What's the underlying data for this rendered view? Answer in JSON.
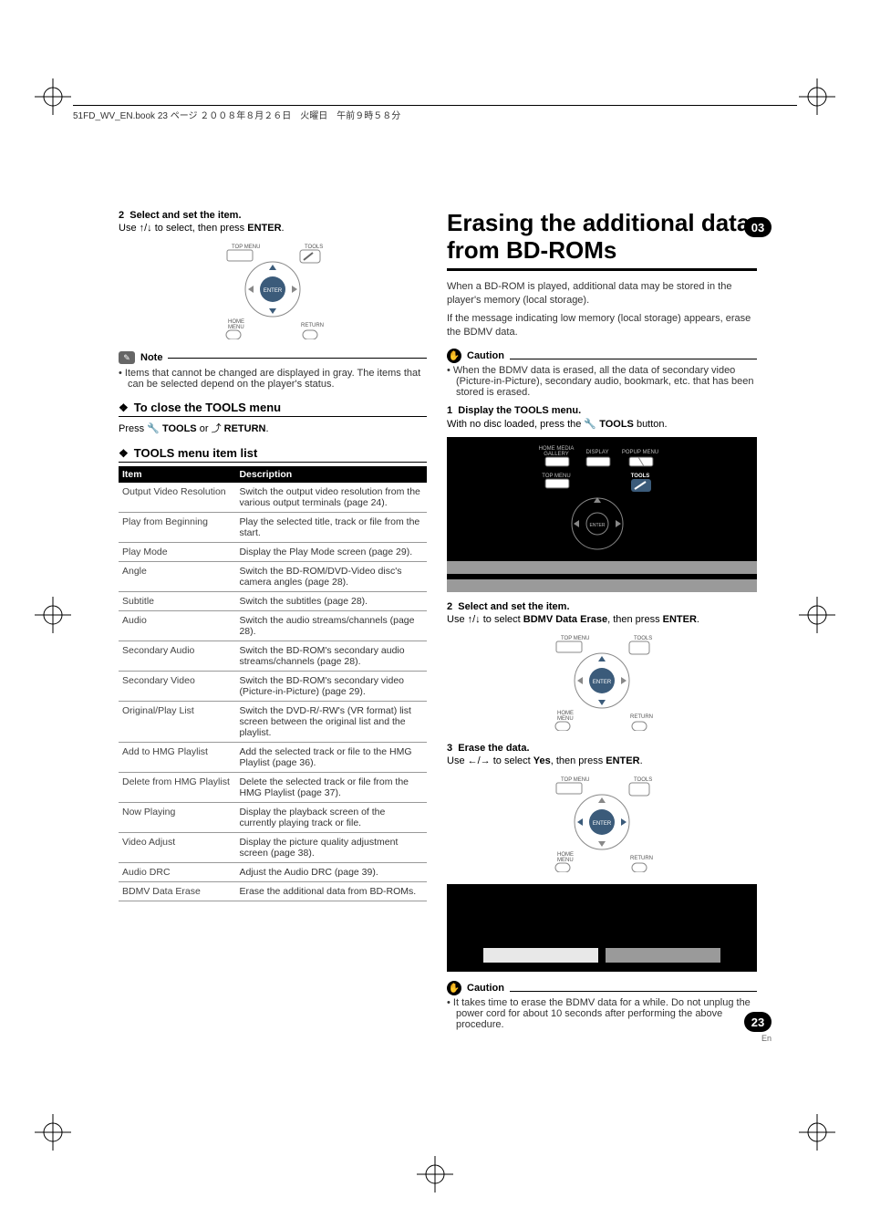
{
  "chapter_number": "03",
  "page_number": "23",
  "page_lang": "En",
  "running_header": "51FD_WV_EN.book  23 ページ  ２００８年８月２６日　火曜日　午前９時５８分",
  "left": {
    "step2_num": "2",
    "step2_title": "Select and set the item.",
    "step2_sub_pre": "Use ",
    "step2_sub_arrows": "↑/↓",
    "step2_sub_mid": " to select, then press ",
    "step2_sub_enter": "ENTER",
    "step2_sub_post": ".",
    "remote_labels": {
      "top_menu": "TOP MENU",
      "tools": "TOOLS",
      "home_menu": "HOME MENU",
      "return": "RETURN",
      "enter": "ENTER"
    },
    "note_label": "Note",
    "note_bullet": "• Items that cannot be changed are displayed in gray. The items that can be selected depend on the player's status.",
    "sect_close": "To close the TOOLS menu",
    "press_pre": "Press ",
    "press_tools": "TOOLS",
    "press_or": " or ",
    "press_return": "RETURN",
    "press_post": ".",
    "sect_list": "TOOLS menu item list",
    "th_item": "Item",
    "th_desc": "Description",
    "rows": [
      {
        "item": "Output Video Resolution",
        "desc": "Switch the output video resolution from the various output terminals (page 24)."
      },
      {
        "item": "Play from Beginning",
        "desc": "Play the selected title, track or file from the start."
      },
      {
        "item": "Play Mode",
        "desc": "Display the Play Mode screen (page 29)."
      },
      {
        "item": "Angle",
        "desc": "Switch the BD-ROM/DVD-Video disc's camera angles (page 28)."
      },
      {
        "item": "Subtitle",
        "desc": "Switch the subtitles (page 28)."
      },
      {
        "item": "Audio",
        "desc": "Switch the audio streams/channels (page 28)."
      },
      {
        "item": "Secondary Audio",
        "desc": "Switch the BD-ROM's secondary audio streams/channels (page 28)."
      },
      {
        "item": "Secondary Video",
        "desc": "Switch the BD-ROM's secondary video (Picture-in-Picture) (page 29)."
      },
      {
        "item": "Original/Play List",
        "desc": "Switch the DVD-R/-RW's (VR format) list screen between the original list and the playlist."
      },
      {
        "item": "Add to HMG Playlist",
        "desc": "Add the selected track or file to the HMG Playlist (page 36)."
      },
      {
        "item": "Delete from HMG Playlist",
        "desc": "Delete the selected track or file from the HMG Playlist (page 37)."
      },
      {
        "item": "Now Playing",
        "desc": "Display the playback screen of the currently playing track or file."
      },
      {
        "item": "Video Adjust",
        "desc": "Display the picture quality adjustment screen (page 38)."
      },
      {
        "item": "Audio DRC",
        "desc": "Adjust the Audio DRC (page 39)."
      },
      {
        "item": "BDMV Data Erase",
        "desc": "Erase the additional data from BD-ROMs."
      }
    ]
  },
  "right": {
    "title": "Erasing the additional data from BD-ROMs",
    "para1": "When a BD-ROM is played, additional data may be stored in the player's memory (local storage).",
    "para2": "If the message indicating low memory (local storage) appears, erase the BDMV data.",
    "caution_label": "Caution",
    "caution1_bullet": "• When the BDMV data is erased, all the data of secondary video (Picture-in-Picture), secondary audio, bookmark, etc. that has been stored is erased.",
    "step1_num": "1",
    "step1_title": "Display the TOOLS menu.",
    "step1_sub_pre": "With no disc loaded, press the ",
    "step1_sub_tools": "TOOLS",
    "step1_sub_post": " button.",
    "remote1_labels": {
      "home_media_gallery": "HOME MEDIA GALLERY",
      "display": "DISPLAY",
      "popup_menu": "POPUP MENU",
      "top_menu": "TOP MENU",
      "tools": "TOOLS",
      "enter": "ENTER"
    },
    "step2_num": "2",
    "step2_title": "Select and set the item.",
    "step2_sub_pre": "Use ",
    "step2_sub_arrows": "↑/↓",
    "step2_sub_mid": " to select ",
    "step2_sub_val": "BDMV Data Erase",
    "step2_sub_mid2": ", then press ",
    "step2_sub_enter": "ENTER",
    "step2_sub_post": ".",
    "step3_num": "3",
    "step3_title": "Erase the data.",
    "step3_sub_pre": "Use ",
    "step3_sub_arrows": "←/→",
    "step3_sub_mid": " to select ",
    "step3_sub_val": "Yes",
    "step3_sub_mid2": ", then press ",
    "step3_sub_enter": "ENTER",
    "step3_sub_post": ".",
    "caution2_bullet": "• It takes time to erase the BDMV data for a while. Do not unplug the power cord for about 10 seconds after performing the above procedure."
  }
}
